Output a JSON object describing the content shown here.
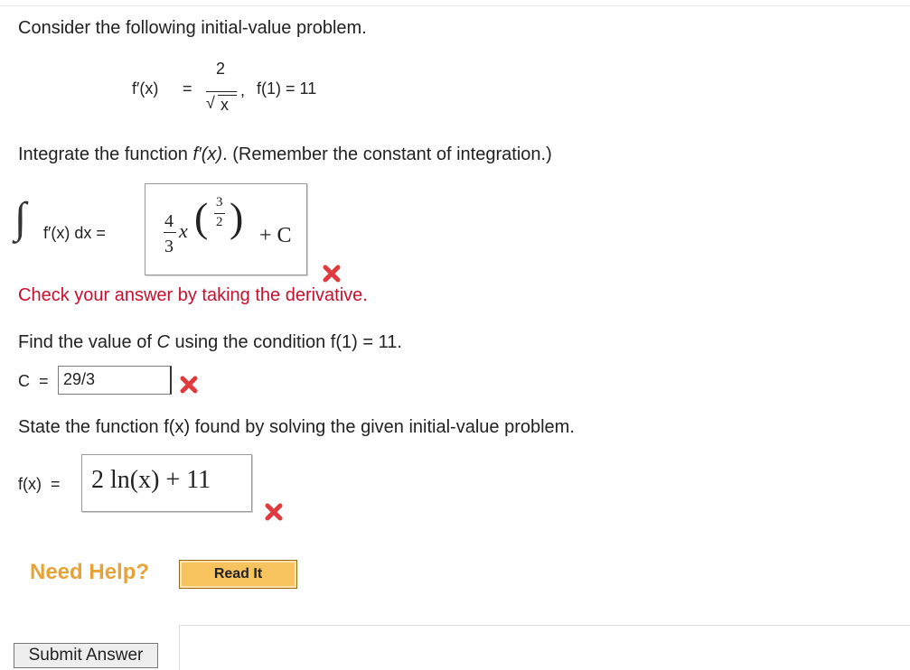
{
  "intro": "Consider the following initial-value problem.",
  "problem": {
    "fprime": "f′(x)",
    "eq": "=",
    "numerator": "2",
    "sqrt_sign": "√",
    "denominator": "x",
    "comma": ",",
    "condition": "f(1) = 11"
  },
  "step1": {
    "instruction_prefix": "Integrate the function ",
    "instruction_func": "f′(x)",
    "instruction_suffix": ". (Remember the constant of integration.)",
    "integral_sign": "∫",
    "integrand": "f′(x) dx =",
    "answer": {
      "coef_num": "4",
      "coef_den": "3",
      "var": "x",
      "lparen": "(",
      "exp_num": "3",
      "exp_den": "2",
      "rparen": ")",
      "plus_c": "+ C"
    },
    "hint": "Check your answer by taking the derivative."
  },
  "step2": {
    "instruction_prefix": "Find the value of ",
    "instruction_var": "C",
    "instruction_mid": " using the condition ",
    "instruction_cond": "f(1) = 11.",
    "label": "C  =",
    "input_value": "29/3"
  },
  "step3": {
    "instruction": "State the function f(x) found by solving the given initial-value problem.",
    "label": "f(x)  =",
    "answer": "2 ln(x) + 11"
  },
  "help": {
    "label": "Need Help?",
    "read_button": "Read It"
  },
  "submit_button": "Submit Answer",
  "colors": {
    "error_red": "#e0393e",
    "hint_red": "#c8102e",
    "help_orange": "#e8a23a"
  }
}
